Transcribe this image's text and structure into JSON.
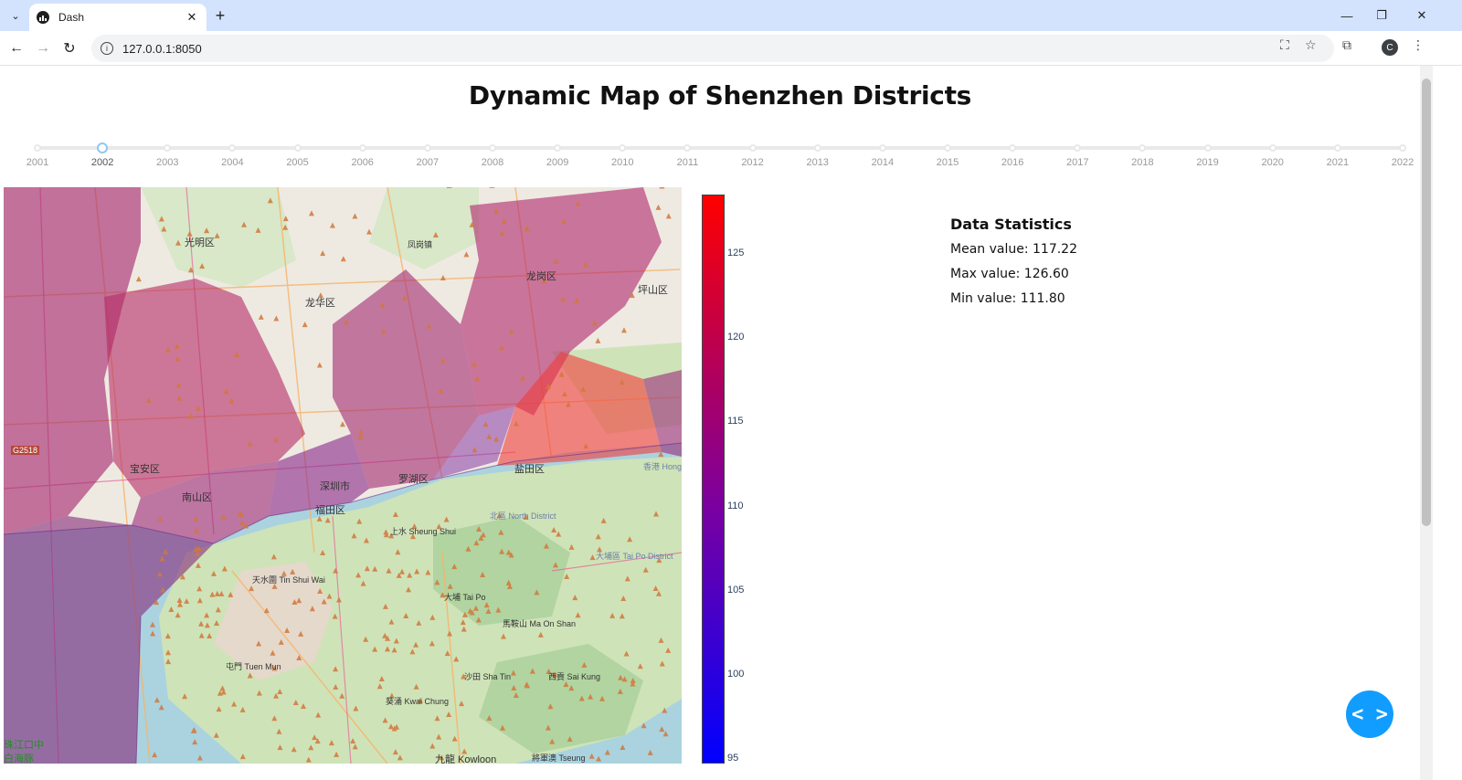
{
  "browser": {
    "tab_title": "Dash",
    "url": "127.0.0.1:8050",
    "profile_initial": "C"
  },
  "page": {
    "title": "Dynamic Map of Shenzhen Districts"
  },
  "slider": {
    "selected": "2002",
    "marks": [
      "2001",
      "2002",
      "2003",
      "2004",
      "2005",
      "2006",
      "2007",
      "2008",
      "2009",
      "2010",
      "2011",
      "2012",
      "2013",
      "2014",
      "2015",
      "2016",
      "2017",
      "2018",
      "2019",
      "2020",
      "2021",
      "2022"
    ]
  },
  "map": {
    "labels": {
      "guangming": "光明区",
      "longhua": "龙华区",
      "longgang": "龙岗区",
      "pingshan": "坪山区",
      "fenggang": "凤岗镇",
      "baoan": "宝安区",
      "nanshan": "南山区",
      "shenzhen": "深圳市",
      "futian": "福田区",
      "luohu": "罗湖区",
      "yantian": "盐田区",
      "sheung_shui": "上水 Sheung Shui",
      "north_district": "北區 North District",
      "tin_shui_wai": "天水圍 Tin Shui Wai",
      "tai_po": "大埔 Tai Po",
      "tai_po_district": "大埔區 Tai Po District",
      "ma_on_shan": "馬鞍山 Ma On Shan",
      "tuen_mun": "屯門 Tuen Mun",
      "sha_tin": "沙田 Sha Tin",
      "sai_kung": "西貢 Sai Kung",
      "kwai_chung": "葵涌 Kwai Chung",
      "kowloon": "九龍 Kowloon",
      "tseung": "將軍澳 Tseung",
      "hong_kong": "香港 Hong",
      "pearl_estuary": "珠江口中",
      "white_dolphin": "白海豚",
      "road_g2518": "G2518"
    }
  },
  "colorbar": {
    "ticks": [
      "125",
      "120",
      "115",
      "110",
      "105",
      "100",
      "95"
    ],
    "color_low": "#0000ff",
    "color_high": "#ff0000"
  },
  "stats": {
    "heading": "Data Statistics",
    "mean": "Mean value: 117.22",
    "max": "Max value: 126.60",
    "min": "Min value: 111.80"
  },
  "fab": {
    "icon": "code-brackets-icon",
    "label": "< >"
  }
}
